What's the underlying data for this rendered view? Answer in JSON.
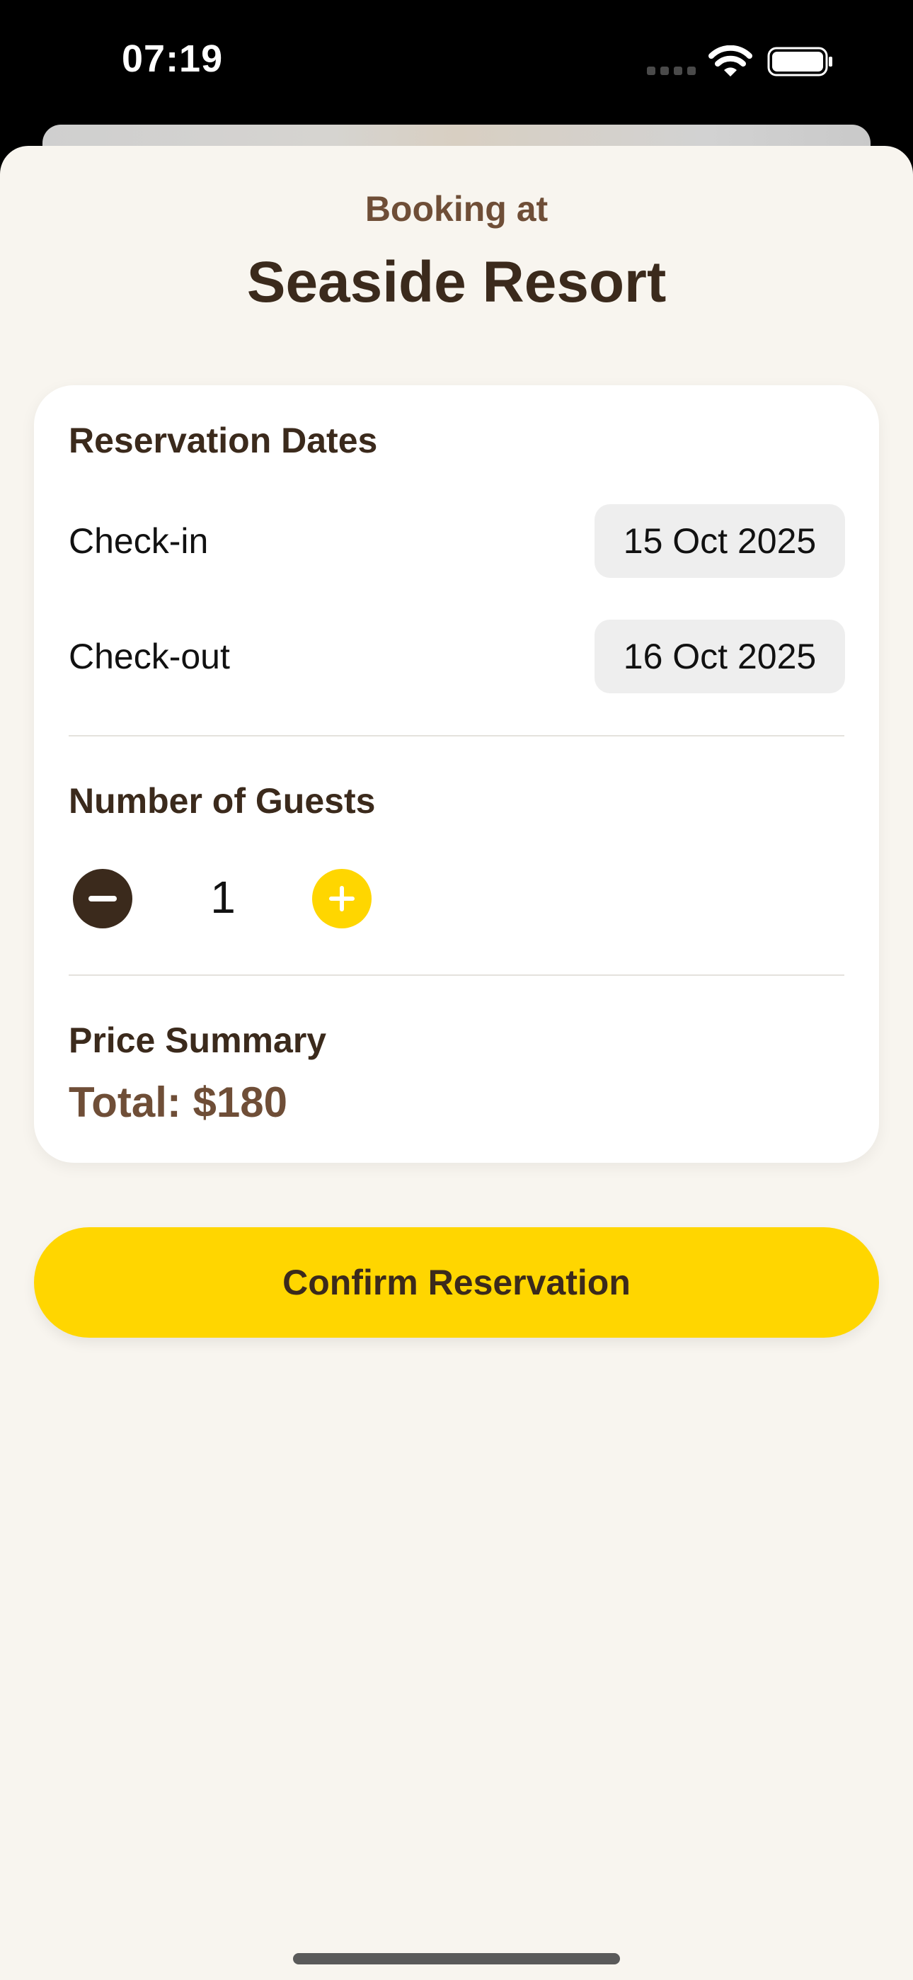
{
  "status_bar": {
    "time": "07:19"
  },
  "header": {
    "subtitle": "Booking at",
    "title": "Seaside Resort"
  },
  "reservation": {
    "heading": "Reservation Dates",
    "check_in_label": "Check-in",
    "check_in_value": "15 Oct 2025",
    "check_out_label": "Check-out",
    "check_out_value": "16 Oct 2025"
  },
  "guests": {
    "heading": "Number of Guests",
    "count": "1"
  },
  "price": {
    "heading": "Price Summary",
    "total": "Total: $180"
  },
  "actions": {
    "confirm_label": "Confirm Reservation"
  },
  "colors": {
    "accent": "#ffd600",
    "brown_dark": "#3b2a1c",
    "brown_medium": "#6f4e37",
    "background": "#f8f5ef"
  },
  "icons": {
    "signal": "signal-icon",
    "wifi": "wifi-icon",
    "battery": "battery-icon",
    "minus": "minus-icon",
    "plus": "plus-icon"
  }
}
